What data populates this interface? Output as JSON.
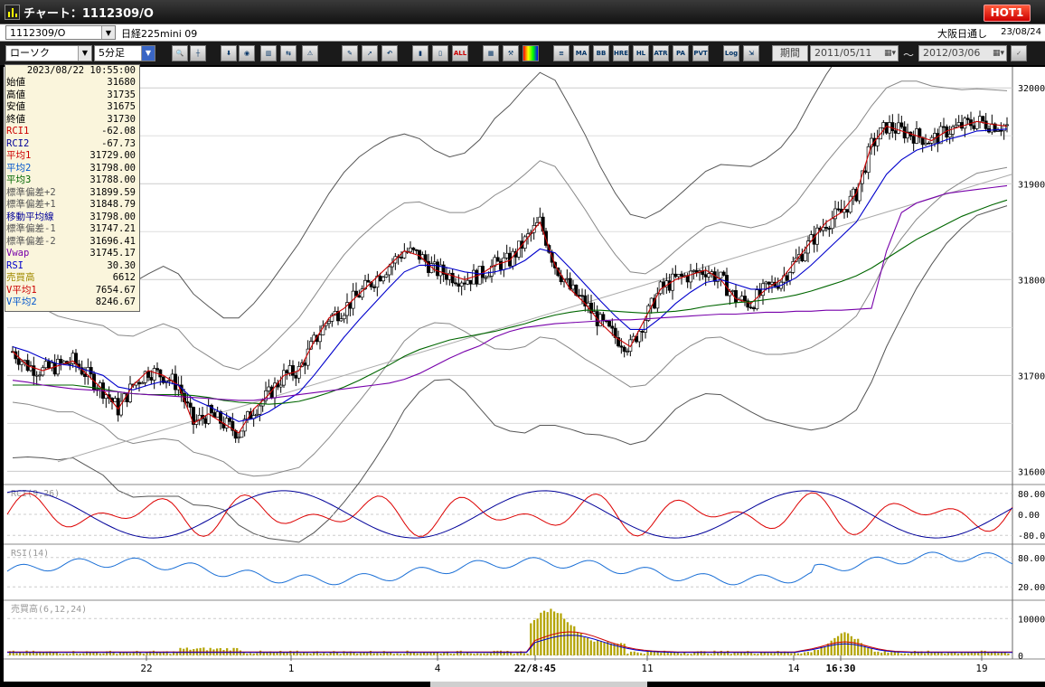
{
  "window": {
    "title": "チャート：1112309/O",
    "hot_badge": "HOT1"
  },
  "infobar": {
    "symbol_code": "1112309/O",
    "symbol_name": "日経225mini 09",
    "session": "大阪日通し",
    "date": "23/08/24"
  },
  "toolbar": {
    "chart_type": "ローソク",
    "interval": "5分足",
    "period_label": "期間",
    "date_from": "2011/05/11",
    "tilde": "～",
    "date_to": "2012/03/06",
    "buttons": [
      "MA",
      "BB",
      "HRE",
      "HL",
      "ATR",
      "PA",
      "PVT",
      "Log",
      "ALL"
    ]
  },
  "colors": {
    "bg": "#000000",
    "panel": "#ffffff",
    "candle": "#000000",
    "avg1": "#cc0000",
    "avg2": "#0000cc",
    "avg3": "#006600",
    "vwap": "#7700aa",
    "rci1": "#dd0000",
    "rci2": "#000099",
    "rsi": "#1a6fd6",
    "volume": "#b3a300"
  },
  "databox": {
    "datetime": "2023/08/22  10:55:00",
    "rows": [
      {
        "label": "始値",
        "value": "31680",
        "color": "#000000"
      },
      {
        "label": "高値",
        "value": "31735",
        "color": "#000000"
      },
      {
        "label": "安値",
        "value": "31675",
        "color": "#000000"
      },
      {
        "label": "終値",
        "value": "31730",
        "color": "#000000"
      },
      {
        "label": "RCI1",
        "value": "-62.08",
        "color": "#cc0000"
      },
      {
        "label": "RCI2",
        "value": "-67.73",
        "color": "#000099"
      },
      {
        "label": "平均1",
        "value": "31729.00",
        "color": "#cc0000"
      },
      {
        "label": "平均2",
        "value": "31798.00",
        "color": "#0055cc"
      },
      {
        "label": "平均3",
        "value": "31788.00",
        "color": "#006600"
      },
      {
        "label": "標準偏差+2",
        "value": "31899.59",
        "color": "#555555"
      },
      {
        "label": "標準偏差+1",
        "value": "31848.79",
        "color": "#555555"
      },
      {
        "label": "移動平均線",
        "value": "31798.00",
        "color": "#000099"
      },
      {
        "label": "標準偏差-1",
        "value": "31747.21",
        "color": "#555555"
      },
      {
        "label": "標準偏差-2",
        "value": "31696.41",
        "color": "#555555"
      },
      {
        "label": "Vwap",
        "value": "31745.17",
        "color": "#7700aa"
      },
      {
        "label": "RSI",
        "value": "30.30",
        "color": "#0000cc"
      },
      {
        "label": "売買高",
        "value": "6612",
        "color": "#a08a00"
      },
      {
        "label": "V平均1",
        "value": "7654.67",
        "color": "#cc0000"
      },
      {
        "label": "V平均2",
        "value": "8246.67",
        "color": "#0055cc"
      }
    ]
  },
  "price_axis": {
    "ticks": [
      "32000",
      "31900",
      "31800",
      "31700",
      "31600"
    ]
  },
  "panels": {
    "rci": {
      "label": "RCI(9,26)",
      "ticks": [
        "80.00",
        "0.00",
        "-80.0"
      ]
    },
    "rsi": {
      "label": "RSI(14)",
      "ticks": [
        "80.00",
        "20.00"
      ]
    },
    "volume": {
      "label": "売買高(6,12,24)",
      "ticks": [
        "10000",
        "0"
      ]
    }
  },
  "time_axis": {
    "labels": [
      "22",
      "1",
      "4",
      "22/8:45",
      "11",
      "14",
      "16:30",
      "19"
    ]
  },
  "chart_data": {
    "type": "line",
    "title": "",
    "ylabel": "",
    "ylim": [
      31590,
      32020
    ],
    "series": [
      {
        "values": [
          31725,
          31710,
          31705,
          31710,
          31715,
          31700,
          31685,
          31665,
          31690,
          31705,
          31700,
          31690,
          31650,
          31660,
          31650,
          31640,
          31665,
          31680,
          31700,
          31705,
          31735,
          31760,
          31770,
          31785,
          31800,
          31815,
          31830,
          31825,
          31810,
          31805,
          31800,
          31805,
          31815,
          31820,
          31840,
          31860,
          31815,
          31790,
          31775,
          31755,
          31740,
          31730,
          31760,
          31790,
          31800,
          31805,
          31810,
          31800,
          31780,
          31775,
          31790,
          31800,
          31820,
          31840,
          31860,
          31870,
          31890,
          31940,
          31960,
          31955,
          31950,
          31945,
          31955,
          31960,
          31965,
          31962,
          31960
        ]
      },
      {
        "values": [
          31730,
          31725,
          31718,
          31712,
          31710,
          31705,
          31700,
          31688,
          31685,
          31690,
          31694,
          31690,
          31675,
          31668,
          31660,
          31652,
          31655,
          31662,
          31672,
          31682,
          31700,
          31720,
          31740,
          31758,
          31775,
          31792,
          31808,
          31815,
          31815,
          31812,
          31808,
          31806,
          31808,
          31812,
          31820,
          31832,
          31828,
          31812,
          31795,
          31778,
          31762,
          31748,
          31748,
          31760,
          31775,
          31787,
          31797,
          31800,
          31795,
          31790,
          31790,
          31794,
          31802,
          31815,
          31830,
          31845,
          31860,
          31885,
          31910,
          31925,
          31935,
          31940,
          31946,
          31950,
          31955,
          31956,
          31957
        ]
      },
      {
        "values": [
          31690,
          31690,
          31690,
          31690,
          31690,
          31688,
          31686,
          31683,
          31681,
          31680,
          31680,
          31680,
          31679,
          31677,
          31674,
          31672,
          31671,
          31670,
          31671,
          31673,
          31677,
          31682,
          31688,
          31695,
          31703,
          31711,
          31720,
          31727,
          31732,
          31737,
          31740,
          31743,
          31746,
          31750,
          31754,
          31759,
          31763,
          31766,
          31768,
          31768,
          31767,
          31766,
          31765,
          31766,
          31767,
          31769,
          31772,
          31774,
          31776,
          31777,
          31779,
          31781,
          31784,
          31788,
          31793,
          31798,
          31804,
          31812,
          31822,
          31832,
          31842,
          31850,
          31858,
          31866,
          31872,
          31878,
          31883
        ]
      },
      {
        "values": [
          31695,
          31693,
          31690,
          31688,
          31686,
          31685,
          31684,
          31683,
          31681,
          31680,
          31679,
          31678,
          31677,
          31676,
          31675,
          31674,
          31674,
          31676,
          31678,
          31680,
          31682,
          31684,
          31686,
          31688,
          31690,
          31692,
          31696,
          31702,
          31710,
          31718,
          31725,
          31731,
          31740,
          31746,
          31750,
          31752,
          31754,
          31755,
          31756,
          31757,
          31758,
          31758,
          31759,
          31760,
          31761,
          31762,
          31763,
          31764,
          31764,
          31765,
          31766,
          31766,
          31767,
          31767,
          31768,
          31768,
          31769,
          31770,
          31830,
          31870,
          31880,
          31885,
          31890,
          31892,
          31894,
          31896,
          31898
        ]
      }
    ]
  }
}
